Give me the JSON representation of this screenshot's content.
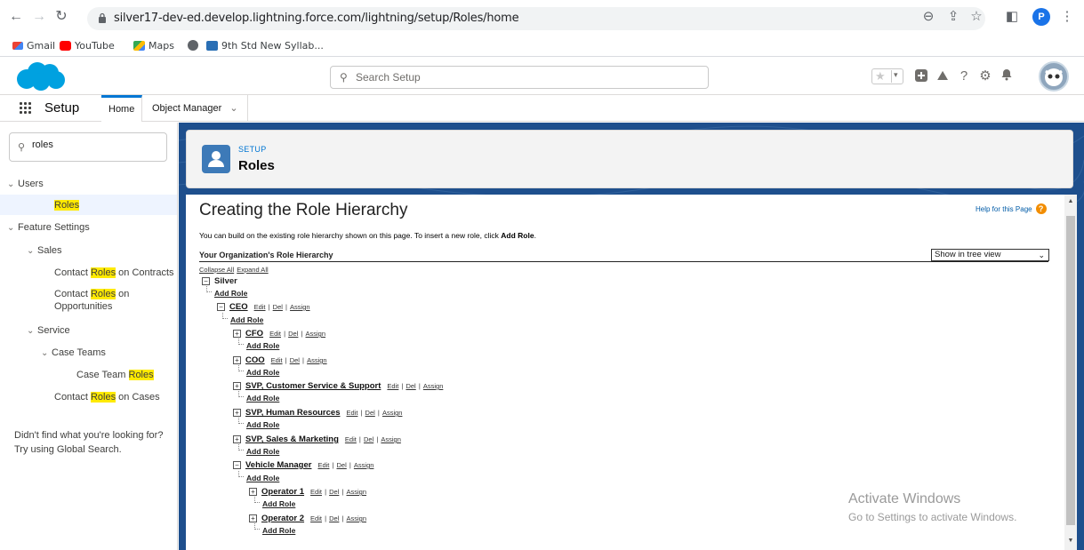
{
  "browser": {
    "url": "silver17-dev-ed.develop.lightning.force.com/lightning/setup/Roles/home",
    "profile_initial": "P",
    "bookmarks": [
      "Gmail",
      "YouTube",
      "Maps",
      "",
      "9th Std New Syllab..."
    ]
  },
  "header": {
    "search_placeholder": "Search Setup"
  },
  "nav": {
    "app_title": "Setup",
    "tabs": [
      "Home",
      "Object Manager"
    ]
  },
  "sidebar": {
    "quickfind_value": "roles",
    "tree": {
      "users": "Users",
      "roles": "Roles",
      "feature_settings": "Feature Settings",
      "sales": "Sales",
      "contact_roles_contracts_pre": "Contact ",
      "contact_roles_contracts_hl": "Roles",
      "contact_roles_contracts_post": " on Contracts",
      "contact_roles_opps_pre": "Contact ",
      "contact_roles_opps_hl": "Roles",
      "contact_roles_opps_post": " on",
      "contact_roles_opps_line2": "Opportunities",
      "service": "Service",
      "case_teams": "Case Teams",
      "case_team_roles_pre": "Case Team ",
      "case_team_roles_hl": "Roles",
      "contact_roles_cases_pre": "Contact ",
      "contact_roles_cases_hl": "Roles",
      "contact_roles_cases_post": " on Cases"
    },
    "help_line1": "Didn't find what you're looking for?",
    "help_line2": "Try using Global Search."
  },
  "page_header": {
    "eyebrow": "SETUP",
    "title": "Roles"
  },
  "main": {
    "heading": "Creating the Role Hierarchy",
    "help_link": "Help for this Page",
    "intro_text": "You can build on the existing role hierarchy shown on this page. To insert a new role, click ",
    "intro_bold": "Add Role",
    "intro_end": ".",
    "subheading": "Your Organization's Role Hierarchy",
    "view_select": "Show in tree view",
    "collapse_all": "Collapse All",
    "expand_all": "Expand All",
    "root": "Silver",
    "add_role": "Add Role",
    "action_edit": "Edit",
    "action_del": "Del",
    "action_assign": "Assign",
    "roles": {
      "ceo": "CEO",
      "cfo": "CFO",
      "coo": "COO",
      "svp_cs": "SVP, Customer Service & Support",
      "svp_hr": "SVP, Human Resources",
      "svp_sm": "SVP, Sales & Marketing",
      "vehicle_manager": "Vehicle Manager",
      "operator1": "Operator 1",
      "operator2": "Operator 2"
    }
  },
  "watermark": {
    "line1": "Activate Windows",
    "line2": "Go to Settings to activate Windows."
  },
  "colors": {
    "brand_blue": "#0176d3",
    "sf_cloud": "#00a1e0",
    "content_bg": "#1e4f8d",
    "highlight": "#ffea00"
  }
}
